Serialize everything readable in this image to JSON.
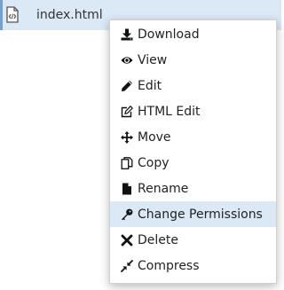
{
  "file_row": {
    "file_name": "index.html",
    "icon": "html-file-icon"
  },
  "context_menu": {
    "items": [
      {
        "label": "Download",
        "icon": "download-icon"
      },
      {
        "label": "View",
        "icon": "eye-icon"
      },
      {
        "label": "Edit",
        "icon": "pencil-icon"
      },
      {
        "label": "HTML Edit",
        "icon": "edit-square-icon"
      },
      {
        "label": "Move",
        "icon": "move-arrows-icon"
      },
      {
        "label": "Copy",
        "icon": "copy-icon"
      },
      {
        "label": "Rename",
        "icon": "file-icon"
      },
      {
        "label": "Change Permissions",
        "icon": "key-icon",
        "highlighted": true
      },
      {
        "label": "Delete",
        "icon": "close-icon"
      },
      {
        "label": "Compress",
        "icon": "compress-icon"
      }
    ]
  },
  "colors": {
    "row_highlight": "#dbe9f6",
    "row_accent": "#6fa3d6",
    "menu_border": "#d0d0d0",
    "text": "#222222"
  }
}
